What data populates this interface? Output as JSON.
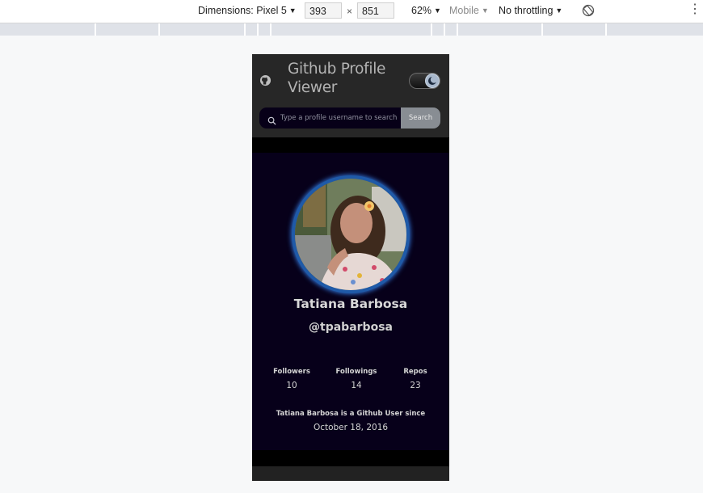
{
  "devtools": {
    "dimensions_label": "Dimensions: Pixel 5",
    "width_value": "393",
    "height_value": "851",
    "times": "×",
    "zoom": "62%",
    "mode": "Mobile",
    "throttling": "No throttling"
  },
  "app": {
    "title": "Github Profile Viewer",
    "search_placeholder": "Type a profile username to search",
    "search_button": "Search",
    "theme_toggle": "dark"
  },
  "profile": {
    "name": "Tatiana Barbosa",
    "login": "@tpabarbosa",
    "stats": [
      {
        "label": "Followers",
        "value": "10"
      },
      {
        "label": "Followings",
        "value": "14"
      },
      {
        "label": "Repos",
        "value": "23"
      }
    ],
    "since_text": "Tatiana Barbosa is a Github User since",
    "since_date": "October 18, 2016"
  },
  "colors": {
    "card_bg": "#07001a",
    "header_bg": "#272727",
    "avatar_ring": "#1f5aa8",
    "search_button_bg": "#888d93"
  },
  "icons": [
    "github-icon",
    "moon-icon",
    "search-icon",
    "rotate-icon",
    "more-vert-icon"
  ]
}
